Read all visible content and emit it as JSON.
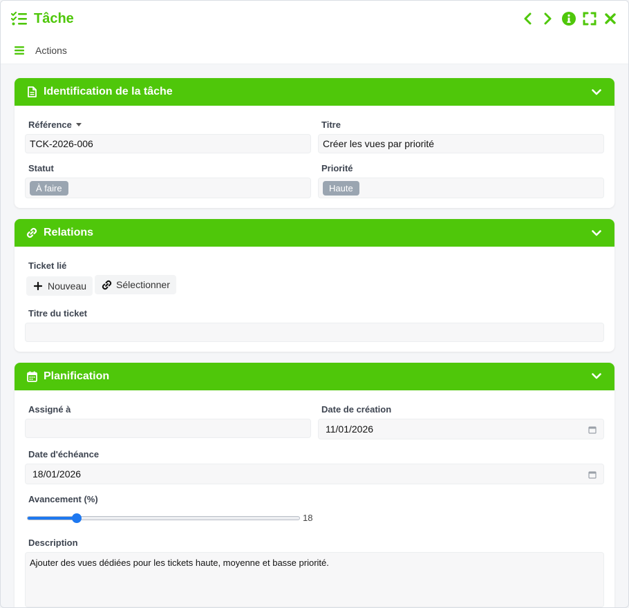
{
  "window": {
    "title": "Tâche",
    "accent": "#4fc70a",
    "controls": [
      "chevron-left-icon",
      "chevron-right-icon",
      "info-icon",
      "fullscreen-icon",
      "close-icon"
    ]
  },
  "actionbar": {
    "label": "Actions"
  },
  "identification": {
    "title": "Identification de la tâche",
    "reference_label": "Référence",
    "reference_value": "TCK-2026-006",
    "titre_label": "Titre",
    "titre_value": "Créer les vues par priorité",
    "statut_label": "Statut",
    "statut_value": "À faire",
    "priorite_label": "Priorité",
    "priorite_value": "Haute"
  },
  "relations": {
    "title": "Relations",
    "ticket_label": "Ticket lié",
    "new_button": "Nouveau",
    "select_button": "Sélectionner",
    "ticket_title_label": "Titre du ticket",
    "ticket_title_value": ""
  },
  "planification": {
    "title": "Planification",
    "assigne_label": "Assigné à",
    "assigne_value": "",
    "creation_label": "Date de création",
    "creation_value": "11/01/2026",
    "echeance_label": "Date d'échéance",
    "echeance_value": "18/01/2026",
    "avancement_label": "Avancement (%)",
    "avancement_value": 18,
    "avancement_text": "18",
    "description_label": "Description",
    "description_value": "Ajouter des vues dédiées pour les tickets haute, moyenne et basse priorité."
  }
}
